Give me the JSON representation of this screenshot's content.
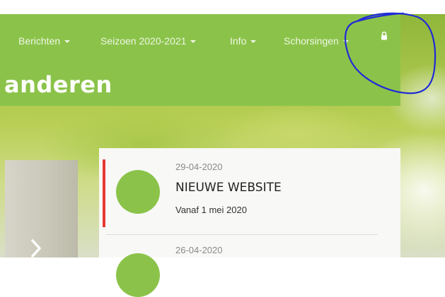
{
  "nav": {
    "items": [
      {
        "label": "Berichten"
      },
      {
        "label": "Seizoen 2020-2021"
      },
      {
        "label": "Info"
      },
      {
        "label": "Schorsingen"
      }
    ],
    "lock_icon": "lock-icon"
  },
  "site": {
    "title_fragment": "anderen"
  },
  "news": [
    {
      "date": "29-04-2020",
      "title": "NIEUWE WEBSITE",
      "subtitle": "Vanaf 1 mei 2020"
    },
    {
      "date": "26-04-2020"
    }
  ],
  "slider": {
    "arrow_icon": "chevron-right-icon"
  },
  "colors": {
    "brand_green": "#8bc34a",
    "accent_red": "#e53935",
    "annotation_blue": "#1f2bd6"
  }
}
